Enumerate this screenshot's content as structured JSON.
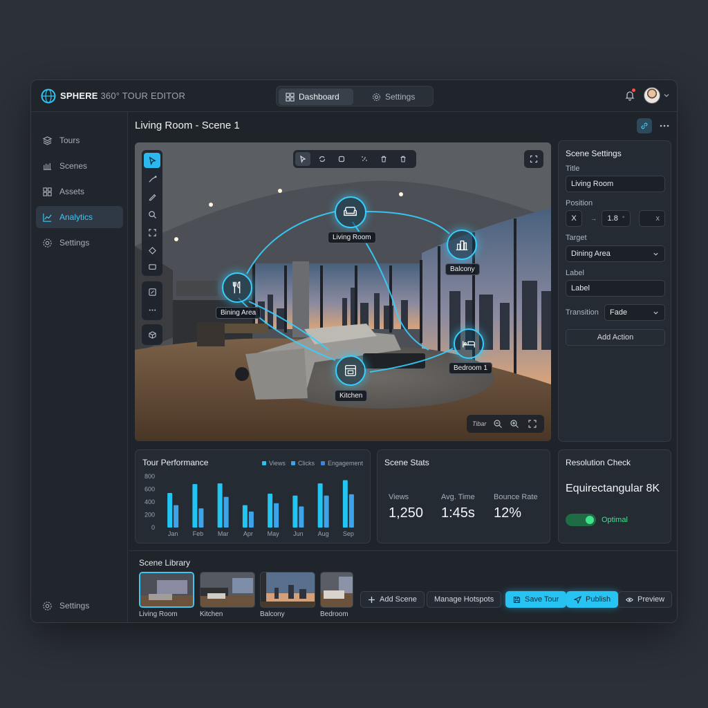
{
  "app": {
    "brand_bold": "SPHERE",
    "brand_rest": " 360° TOUR EDITOR"
  },
  "nav": {
    "tabs": [
      {
        "label": "Dashboard",
        "active": true
      },
      {
        "label": "Settings",
        "active": false
      }
    ]
  },
  "sidebar": {
    "items": [
      {
        "label": "Tours",
        "icon": "layers-icon"
      },
      {
        "label": "Scenes",
        "icon": "scenes-icon"
      },
      {
        "label": "Assets",
        "icon": "grid-icon"
      },
      {
        "label": "Analytics",
        "icon": "chart-icon",
        "active": true
      },
      {
        "label": "Settings",
        "icon": "gear-icon"
      }
    ],
    "footer_label": "Settings"
  },
  "page": {
    "title": "Living Room - Scene 1"
  },
  "viewer": {
    "zoom_label": "Tibar",
    "hotspots": [
      {
        "label": "Living Room",
        "icon": "sofa-icon"
      },
      {
        "label": "Balcony",
        "icon": "city-icon"
      },
      {
        "label": "Bining Area",
        "icon": "utensils-icon"
      },
      {
        "label": "Kitchen",
        "icon": "oven-icon"
      },
      {
        "label": "Bedroom 1",
        "icon": "bed-icon"
      }
    ]
  },
  "scene_settings": {
    "title": "Scene Settings",
    "title_label": "Title",
    "title_value": "Living Room",
    "position_label": "Position",
    "pos_x": "X",
    "pos_arrow": "→",
    "pos_value": "1.8",
    "pos_unit": "°",
    "pos_close": "x",
    "target_label": "Target",
    "target_value": "Dining Area",
    "label_label": "Label",
    "label_value": "Label",
    "transition_label": "Transition",
    "transition_value": "Fade",
    "add_action": "Add Action"
  },
  "tour_performance": {
    "title": "Tour Performance",
    "legend": [
      {
        "name": "Views",
        "color": "#22c4f2"
      },
      {
        "name": "Clicks",
        "color": "#3da4ea"
      },
      {
        "name": "Engagement",
        "color": "#3b86d9"
      }
    ]
  },
  "chart_data": {
    "type": "bar",
    "title": "Tour Performance",
    "categories": [
      "Jan",
      "Feb",
      "Mar",
      "Apr",
      "May",
      "Jun",
      "Aug",
      "Sep"
    ],
    "series": [
      {
        "name": "Views",
        "values": [
          540,
          680,
          690,
          350,
          530,
          500,
          690,
          740
        ]
      },
      {
        "name": "Clicks",
        "values": [
          350,
          300,
          480,
          250,
          380,
          330,
          500,
          520
        ]
      }
    ],
    "ylim": [
      0,
      800
    ],
    "yticks": [
      0,
      200,
      400,
      600,
      800
    ],
    "grid": false,
    "legend_position": "top-right"
  },
  "scene_stats": {
    "title": "Scene Stats",
    "stats": [
      {
        "label": "Views",
        "value": "1,250"
      },
      {
        "label": "Avg. Time",
        "value": "1:45s"
      },
      {
        "label": "Bounce Rate",
        "value": "12%"
      }
    ]
  },
  "resolution": {
    "title": "Resolution Check",
    "value": "Equirectangular 8K",
    "status": "Optimal",
    "status_color": "#3fe28a"
  },
  "library": {
    "title": "Scene Library",
    "scenes": [
      {
        "label": "Living Room",
        "active": true
      },
      {
        "label": "Kitchen"
      },
      {
        "label": "Balcony"
      },
      {
        "label": "Bedroom"
      }
    ],
    "buttons": {
      "add_scene": "Add Scene",
      "manage_hotspots": "Manage Hotspots",
      "save_tour": "Save Tour",
      "publish": "Publish",
      "preview": "Preview"
    }
  },
  "colors": {
    "accent": "#27c3f3",
    "background": "#2c3139",
    "panel": "#252b33"
  }
}
